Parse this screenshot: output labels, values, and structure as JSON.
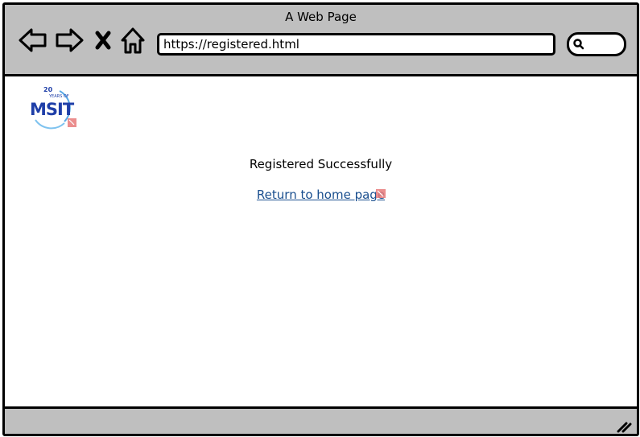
{
  "window": {
    "title": "A Web Page"
  },
  "toolbar": {
    "url": "https://registered.html",
    "icons": [
      "back-arrow-icon",
      "forward-arrow-icon",
      "close-x-icon",
      "home-icon",
      "search-icon"
    ]
  },
  "content": {
    "logo": {
      "icon": "msit-logo",
      "text": "MSIT",
      "tagline": "20 YEARS OF"
    },
    "message": "Registered Successfully",
    "link_text": "Return to home page"
  },
  "colors": {
    "chrome": "#bfbfbf",
    "link": "#1a4f8f",
    "logo_blue": "#1f3fa8",
    "marker": "#e87a7a"
  }
}
